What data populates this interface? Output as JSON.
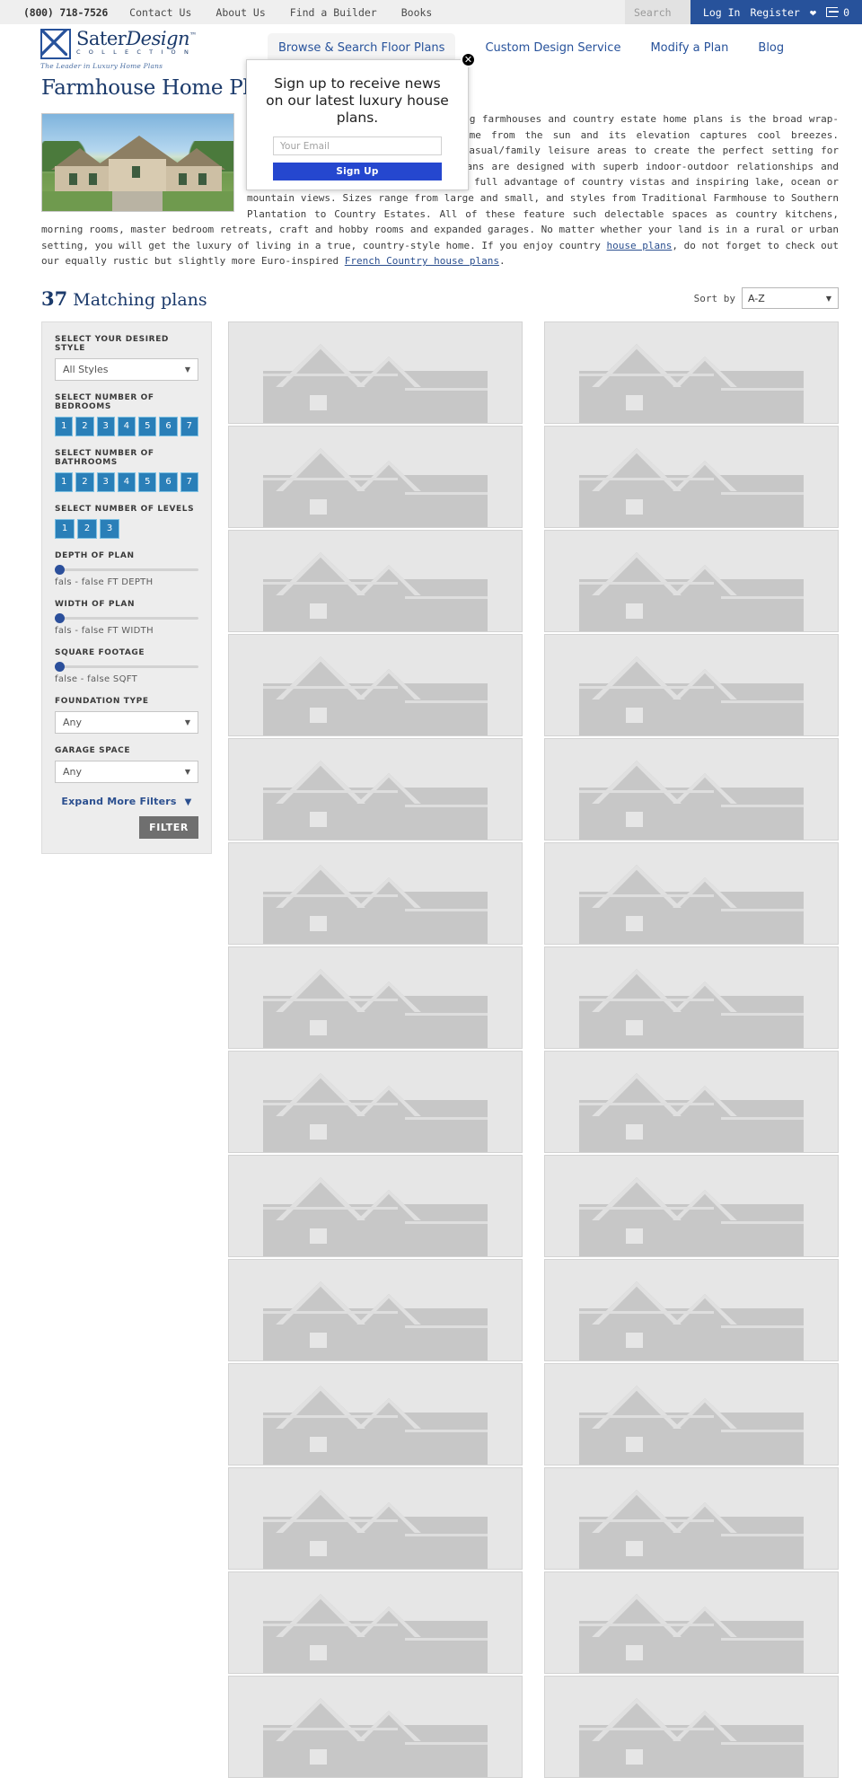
{
  "topbar": {
    "phone": "(800) 718-7526",
    "links": [
      {
        "label": "Contact Us"
      },
      {
        "label": "About Us"
      },
      {
        "label": "Find a Builder"
      },
      {
        "label": "Books"
      }
    ],
    "search_placeholder": "Search",
    "search_value": "",
    "login": "Log In",
    "register": "Register",
    "cart_count": "0"
  },
  "brand": {
    "name_a": "Sater",
    "name_b": "Design",
    "tm": "™",
    "collection": "C O L L E C T I O N",
    "tagline": "The Leader in Luxury Home Plans"
  },
  "nav": [
    {
      "label": "Browse & Search Floor Plans",
      "active": true
    },
    {
      "label": "Custom Design Service",
      "active": false
    },
    {
      "label": "Modify a Plan",
      "active": false
    },
    {
      "label": "Blog",
      "active": false
    }
  ],
  "intro": {
    "title": "Farmhouse Home Plans",
    "p1": "Perhaps the most universally appealing farmhouses and country estate home plans is the broad wrap-around porch which shelters the home from the sun and its elevation captures cool breezes. Farmhouse plans combine formal and casual/family leisure areas to create the perfect setting for casual entertaining. Country home plans are designed with superb indoor-outdoor relationships and many features, such as verandas, take full advantage of country vistas and inspiring lake, ocean or mountain views. Sizes range from large and small, and styles from Traditional Farmhouse to Southern Plantation to Country Estates. All of these feature such delectable spaces as country kitchens, morning rooms, master bedroom retreats, craft and hobby rooms and expanded garages. No matter whether your land is in a rural or urban setting, you will get the luxury of living in a true, country-style home. If you enjoy country ",
    "link1": "house plans",
    "p2": ", do not forget to check out our equally rustic but slightly more Euro-inspired ",
    "link2": "French Country house plans",
    "p3": "."
  },
  "results": {
    "count": "37",
    "matching_label": "Matching plans",
    "sort_label": "Sort by",
    "sort_value": "A-Z"
  },
  "filters": {
    "style_label": "SELECT YOUR DESIRED STYLE",
    "style_value": "All Styles",
    "bedrooms_label": "SELECT NUMBER OF BEDROOMS",
    "bedrooms": [
      "1",
      "2",
      "3",
      "4",
      "5",
      "6",
      "7"
    ],
    "bathrooms_label": "SELECT NUMBER OF BATHROOMS",
    "bathrooms": [
      "1",
      "2",
      "3",
      "4",
      "5",
      "6",
      "7"
    ],
    "levels_label": "SELECT NUMBER OF LEVELS",
    "levels": [
      "1",
      "2",
      "3"
    ],
    "depth_label": "DEPTH OF PLAN",
    "depth_range": "fals - false FT DEPTH",
    "width_label": "WIDTH OF PLAN",
    "width_range": "fals - false FT WIDTH",
    "sqft_label": "SQUARE FOOTAGE",
    "sqft_range": "false  -  false  SQFT",
    "foundation_label": "FOUNDATION TYPE",
    "foundation_value": "Any",
    "garage_label": "GARAGE SPACE",
    "garage_value": "Any",
    "expand_label": "Expand More Filters",
    "filter_button": "FILTER"
  },
  "modal": {
    "heading": "Sign up to receive news on our latest luxury house plans.",
    "email_placeholder": "Your Email",
    "email_value": "",
    "signup_label": "Sign Up",
    "close_label": "✕"
  },
  "plan_cards": [
    {
      "id": "plan-1"
    },
    {
      "id": "plan-2"
    },
    {
      "id": "plan-3"
    },
    {
      "id": "plan-4"
    },
    {
      "id": "plan-5"
    },
    {
      "id": "plan-6"
    },
    {
      "id": "plan-7"
    },
    {
      "id": "plan-8"
    },
    {
      "id": "plan-9"
    },
    {
      "id": "plan-10"
    },
    {
      "id": "plan-11"
    },
    {
      "id": "plan-12"
    },
    {
      "id": "plan-13"
    },
    {
      "id": "plan-14"
    },
    {
      "id": "plan-15"
    },
    {
      "id": "plan-16"
    },
    {
      "id": "plan-17"
    },
    {
      "id": "plan-18"
    },
    {
      "id": "plan-19"
    },
    {
      "id": "plan-20"
    },
    {
      "id": "plan-21"
    },
    {
      "id": "plan-22"
    },
    {
      "id": "plan-23"
    },
    {
      "id": "plan-24"
    },
    {
      "id": "plan-25"
    },
    {
      "id": "plan-26"
    },
    {
      "id": "plan-27"
    },
    {
      "id": "plan-28"
    }
  ],
  "colors": {
    "brand_blue": "#27529b",
    "accent_blue": "#2a7fb8",
    "cta_blue": "#2547cf",
    "filter_gray": "#6f6f6f"
  }
}
